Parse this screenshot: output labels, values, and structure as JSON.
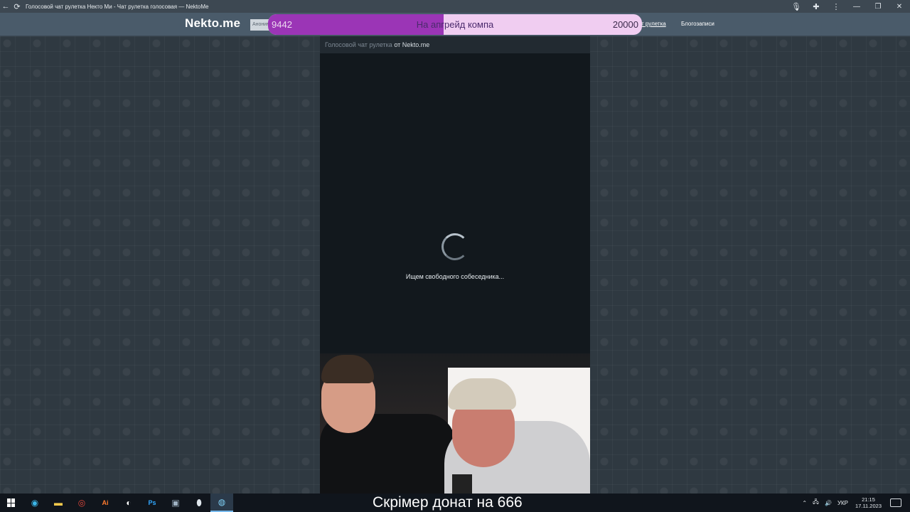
{
  "browser": {
    "title": "Голосовой чат рулетка Некто Ми - Чат рулетка голосовая — NektoMe",
    "icons": [
      "back-arrow-icon",
      "reload-icon",
      "microphone-icon",
      "extensions-puzzle-icon",
      "kebab-menu-icon"
    ],
    "window_controls": [
      "minimize",
      "restore",
      "close"
    ]
  },
  "header": {
    "logo": "Nekto.me",
    "anon_chip": "Аноним",
    "nav_roulette": "т рулетка",
    "nav_blog": "Блогозаписи"
  },
  "goal": {
    "current": "9442",
    "title": "На апгрейд компа",
    "target": "20000",
    "progress": 0.47,
    "fill_color": "#9b35b6",
    "bg_color": "#f0cdf1"
  },
  "panel": {
    "head_link": "Голосовой чат рулетка",
    "head_from": "от Nekto.me",
    "status": "Ищем свободного собеседника..."
  },
  "webcam": {
    "description_icon": "webcam-feed"
  },
  "taskbar": {
    "caption": "Скрімер донат на 666",
    "apps": [
      "windows-start-icon",
      "edge-icon",
      "file-explorer-icon",
      "chrome-icon",
      "illustrator-icon",
      "obs-icon",
      "photoshop-icon",
      "capcut-icon",
      "app-icon",
      "browser-active-icon"
    ],
    "illustrator_label": "Ai",
    "photoshop_label": "Ps",
    "tray_lang": "УКР",
    "time": "21:15",
    "date": "17.11.2023"
  }
}
